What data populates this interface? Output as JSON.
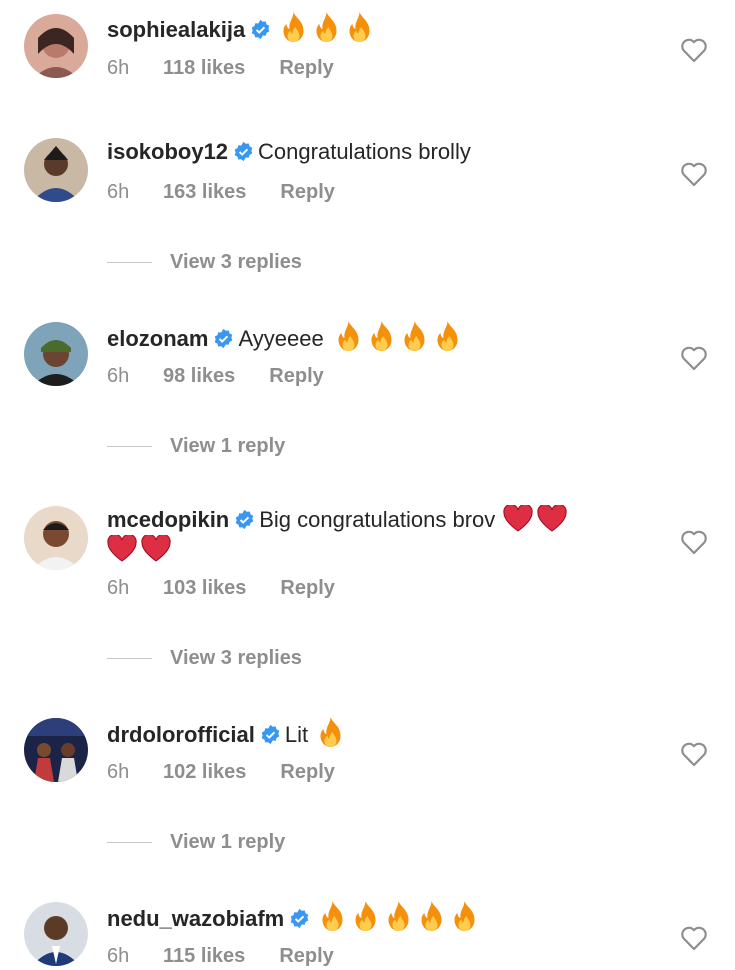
{
  "comments": [
    {
      "username": "sophiealakija",
      "text": "",
      "emoji_count": 3,
      "emoji_type": "fire",
      "time": "6h",
      "likes": "118 likes",
      "reply": "Reply",
      "view_replies": ""
    },
    {
      "username": "isokoboy12",
      "text": "Congratulations brolly",
      "emoji_count": 0,
      "emoji_type": "",
      "time": "6h",
      "likes": "163 likes",
      "reply": "Reply",
      "view_replies": "View 3 replies"
    },
    {
      "username": "elozonam",
      "text": "Ayyeeee",
      "emoji_count": 4,
      "emoji_type": "fire",
      "time": "6h",
      "likes": "98 likes",
      "reply": "Reply",
      "view_replies": "View 1 reply"
    },
    {
      "username": "mcedopikin",
      "text": "Big congratulations brov",
      "emoji_count": 2,
      "emoji_type": "heart",
      "second_line_emoji_count": 2,
      "time": "6h",
      "likes": "103 likes",
      "reply": "Reply",
      "view_replies": "View 3 replies"
    },
    {
      "username": "drdolorofficial",
      "text": "Lit",
      "emoji_count": 1,
      "emoji_type": "fire",
      "time": "6h",
      "likes": "102 likes",
      "reply": "Reply",
      "view_replies": "View 1 reply"
    },
    {
      "username": "nedu_wazobiafm",
      "text": "",
      "emoji_count": 5,
      "emoji_type": "fire",
      "time": "6h",
      "likes": "115 likes",
      "reply": "Reply",
      "view_replies": ""
    }
  ],
  "icons": {
    "verified": "verified-badge-icon",
    "like": "heart-outline-icon",
    "fire": "fire-emoji",
    "red_heart": "red-heart-emoji"
  },
  "colors": {
    "text": "#262626",
    "secondary": "#8e8e8e",
    "verified": "#3897f0",
    "divider": "#c7c7c7"
  }
}
